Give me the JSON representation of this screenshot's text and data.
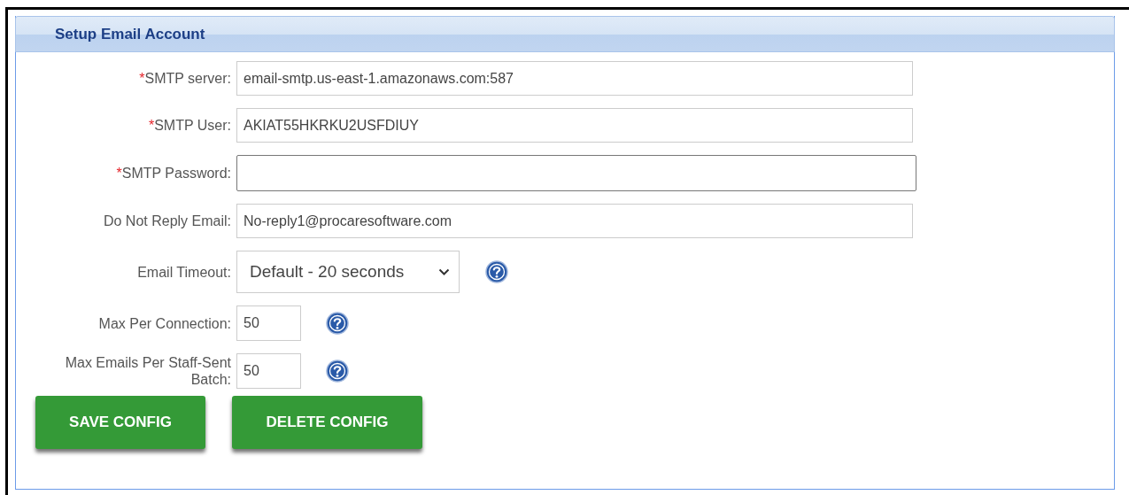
{
  "panel": {
    "title": "Setup Email Account"
  },
  "fields": [
    {
      "kind": "text",
      "required_mark": "*",
      "label": "SMTP server:",
      "value": "email-smtp.us-east-1.amazonaws.com:587",
      "focused": false,
      "help": false
    },
    {
      "kind": "text",
      "required_mark": "*",
      "label": "SMTP User:",
      "value": "AKIAT55HKRKU2USFDIUY",
      "focused": false,
      "help": false
    },
    {
      "kind": "text",
      "required_mark": "*",
      "label": "SMTP Password:",
      "focused": true,
      "help": false
    },
    {
      "kind": "text",
      "label": "Do Not Reply Email:",
      "value": "No-reply1@procaresoftware.com",
      "focused": false,
      "help": false
    },
    {
      "kind": "select",
      "label": "Email Timeout:",
      "value": "Default - 20 seconds",
      "focused": false,
      "help": true
    },
    {
      "kind": "number",
      "label": "Max Per Connection:",
      "value": "50",
      "focused": false,
      "help": true
    },
    {
      "kind": "number",
      "label": "Max Emails Per Staff-Sent Batch:",
      "value": "50",
      "focused": false,
      "help": true
    }
  ],
  "buttons": [
    "SAVE CONFIG",
    "DELETE CONFIG"
  ]
}
